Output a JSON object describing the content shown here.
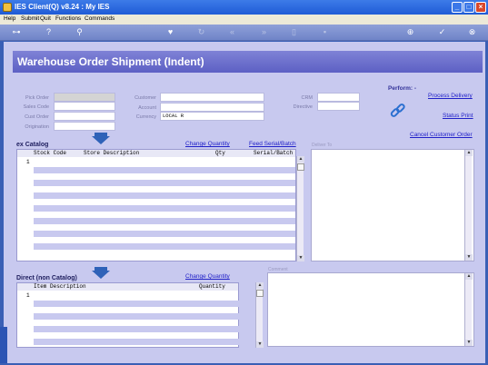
{
  "window": {
    "title": "IES Client(Q) v8.24 : My IES"
  },
  "menu": {
    "items": [
      "Help",
      "Submit",
      "Quit",
      "Functions",
      "Commands"
    ]
  },
  "toolbar": {
    "icons": [
      "key-icon",
      "help-icon",
      "search-icon",
      "heart-icon",
      "refresh-icon",
      "rewind-icon",
      "fast-forward-icon",
      "bookmark-icon",
      "document-icon",
      "add-icon",
      "check-icon",
      "close-icon"
    ]
  },
  "page": {
    "title": "Warehouse Order Shipment (Indent)"
  },
  "form": {
    "pick_order_label": "Pick Order",
    "sales_code_label": "Sales Code",
    "cust_order_label": "Cust Order",
    "origination_label": "Origination",
    "customer_label": "Customer",
    "account_label": "Account",
    "currency_label": "Currency",
    "currency_value": "LOCAL R",
    "crm_label": "CRM",
    "directive_label": "Directive"
  },
  "perform": {
    "label": "Perform: -",
    "process_delivery": "Process Delivery",
    "status_print": "Status Print",
    "cancel_customer_order": "Cancel Customer Order"
  },
  "catalog": {
    "section_label": "ex Catalog",
    "change_quantity": "Change Quantity",
    "feed_serial": "Feed Serial/Batch",
    "deliver_to_label": "Deliver To",
    "columns": [
      "Stock Code",
      "Store Description",
      "Qty",
      "Serial/Batch"
    ],
    "row_number": "1"
  },
  "non_catalog": {
    "section_label": "Direct (non Catalog)",
    "change_quantity": "Change Quantity",
    "comment_label": "Comment",
    "columns": [
      "Item Description",
      "Quantity"
    ],
    "row_number": "1"
  }
}
